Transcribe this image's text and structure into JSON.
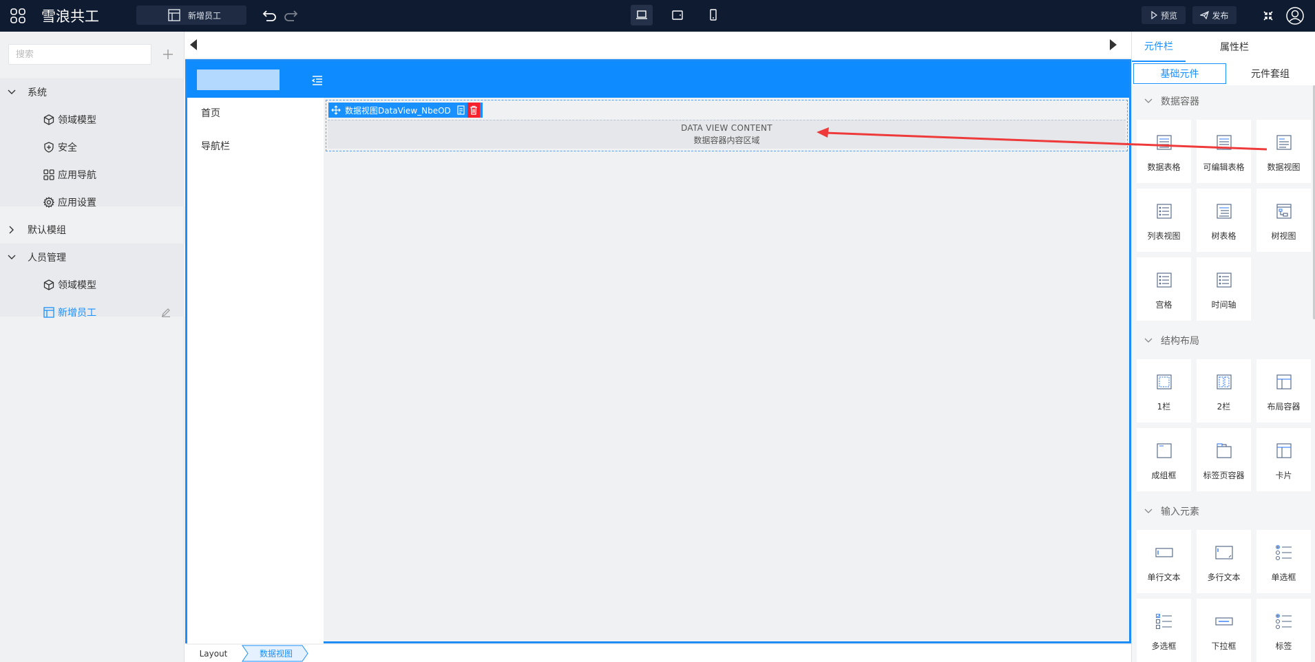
{
  "topbar": {
    "app_title": "雪浪共工",
    "current_page": "新增员工",
    "preview_label": "预览",
    "publish_label": "发布"
  },
  "sidebar": {
    "search_placeholder": "搜索",
    "groups": [
      {
        "label": "系统",
        "expanded": true,
        "items": [
          {
            "label": "领域模型",
            "icon": "cube-icon"
          },
          {
            "label": "安全",
            "icon": "shield-icon"
          },
          {
            "label": "应用导航",
            "icon": "grid-icon"
          },
          {
            "label": "应用设置",
            "icon": "gear-icon"
          }
        ]
      },
      {
        "label": "默认模组",
        "expanded": false,
        "items": []
      },
      {
        "label": "人员管理",
        "expanded": true,
        "items": [
          {
            "label": "领域模型",
            "icon": "cube-icon"
          },
          {
            "label": "新增员工",
            "icon": "page-layout-icon",
            "active": true
          }
        ]
      }
    ]
  },
  "canvas": {
    "nav_items": [
      "首页",
      "导航栏"
    ],
    "dataview_name": "数据视图DataView_NbeOD",
    "content_en": "DATA VIEW CONTENT",
    "content_cn": "数据容器内容区域",
    "breadcrumb": [
      "Layout",
      "数据视图"
    ]
  },
  "right_panel": {
    "tabs": [
      "元件栏",
      "属性栏"
    ],
    "sub_tabs": [
      "基础元件",
      "元件套组"
    ],
    "sections": [
      {
        "title": "数据容器",
        "items": [
          "数据表格",
          "可编辑表格",
          "数据视图",
          "列表视图",
          "树表格",
          "树视图",
          "宫格",
          "时间轴"
        ]
      },
      {
        "title": "结构布局",
        "items": [
          "1栏",
          "2栏",
          "布局容器",
          "成组框",
          "标签页容器",
          "卡片"
        ]
      },
      {
        "title": "输入元素",
        "items": [
          "单行文本",
          "多行文本",
          "单选框",
          "多选框",
          "下拉框",
          "标签"
        ]
      }
    ]
  },
  "colors": {
    "topbar_bg": "#0f1b30",
    "accent": "#1890ff",
    "app_header": "#0e8cff",
    "delete": "#f5222d",
    "arrow": "#ee3a3a"
  }
}
